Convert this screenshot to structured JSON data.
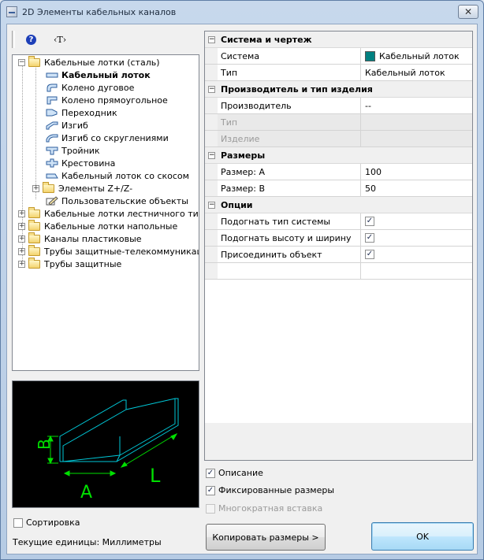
{
  "window": {
    "title": "2D Элементы кабельных каналов",
    "close_symbol": "✕"
  },
  "toolbar": {
    "help_symbol": "?",
    "text_tool_label": "‹T›",
    "icons": [
      "grip-icon",
      "help-icon",
      "text-tool-icon"
    ]
  },
  "tree": {
    "items": [
      {
        "label": "Кабельные лотки (сталь)",
        "icon": "folder-icon",
        "expander": "−"
      },
      {
        "label": "Кабельный лоток",
        "icon": "tray-icon",
        "selected": true
      },
      {
        "label": "Колено дуговое",
        "icon": "arc-elbow-icon"
      },
      {
        "label": "Колено прямоугольное",
        "icon": "rect-elbow-icon"
      },
      {
        "label": "Переходник",
        "icon": "reducer-icon"
      },
      {
        "label": "Изгиб",
        "icon": "bend-icon"
      },
      {
        "label": "Изгиб со скруглениями",
        "icon": "rounded-bend-icon"
      },
      {
        "label": "Тройник",
        "icon": "tee-icon"
      },
      {
        "label": "Крестовина",
        "icon": "cross-icon"
      },
      {
        "label": "Кабельный лоток со скосом",
        "icon": "bevel-tray-icon"
      },
      {
        "label": "Элементы Z+/Z-",
        "icon": "folder-icon",
        "expander": "+"
      },
      {
        "label": "Пользовательские объекты",
        "icon": "user-object-icon"
      },
      {
        "label": "Кабельные лотки лестничного типа",
        "icon": "folder-icon",
        "expander": "+"
      },
      {
        "label": "Кабельные лотки напольные",
        "icon": "folder-icon",
        "expander": "+"
      },
      {
        "label": "Каналы пластиковые",
        "icon": "folder-icon",
        "expander": "+"
      },
      {
        "label": "Трубы защитные-телекоммуникации",
        "icon": "folder-icon",
        "expander": "+"
      },
      {
        "label": "Трубы защитные",
        "icon": "folder-icon",
        "expander": "+"
      }
    ]
  },
  "preview": {
    "dim_b": "B",
    "dim_a": "A",
    "dim_l": "L",
    "colors": {
      "outline": "#00c8d8",
      "dimension": "#00e000",
      "background": "#000000"
    }
  },
  "options": {
    "sort_label": "Сортировка",
    "sort_checked": false,
    "units_text": "Текущие единицы: Миллиметры",
    "description_label": "Описание",
    "description_checked": true,
    "fixed_sizes_label": "Фиксированные размеры",
    "fixed_sizes_checked": true,
    "multi_insert_label": "Многократная вставка",
    "multi_insert_checked": false
  },
  "properties": {
    "cat_system": "Система и чертеж",
    "system_label": "Система",
    "system_value": "Кабельный лоток",
    "system_color": "#008080",
    "type_label": "Тип",
    "type_value": "Кабельный лоток",
    "cat_manufacturer": "Производитель и тип изделия",
    "manufacturer_label": "Производитель",
    "manufacturer_value": "--",
    "product_type_label": "Тип",
    "product_label": "Изделие",
    "cat_sizes": "Размеры",
    "size_a_label": "Размер: A",
    "size_a_value": "100",
    "size_b_label": "Размер: B",
    "size_b_value": "50",
    "cat_options": "Опции",
    "fit_system_label": "Подогнать тип системы",
    "fit_size_label": "Подогнать высоту и ширину",
    "attach_label": "Присоединить объект",
    "collapse_symbol": "−",
    "check_symbol": "✓"
  },
  "buttons": {
    "copy_sizes": "Копировать размеры >",
    "ok": "OK"
  }
}
